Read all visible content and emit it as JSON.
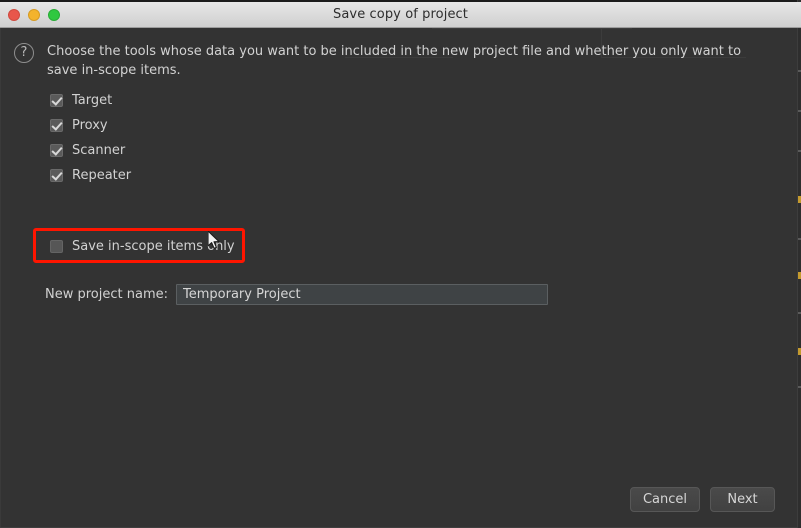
{
  "window": {
    "title": "Save copy of project",
    "traffic_lights": [
      {
        "name": "close",
        "color": "#e8564b"
      },
      {
        "name": "minimize",
        "color": "#f3b32c"
      },
      {
        "name": "zoom",
        "color": "#30c840"
      }
    ]
  },
  "dialog": {
    "help_icon": "?",
    "description": "Choose the tools whose data you want to be included in the new project file and whether you only want to save in-scope items.",
    "tools": [
      {
        "label": "Target",
        "checked": true
      },
      {
        "label": "Proxy",
        "checked": true
      },
      {
        "label": "Scanner",
        "checked": true
      },
      {
        "label": "Repeater",
        "checked": true
      }
    ],
    "scope_option": {
      "label": "Save in-scope items only",
      "checked": false,
      "highlight_color": "#ff1500"
    },
    "project_name": {
      "label": "New project name:",
      "value": "Temporary Project",
      "placeholder": "Temporary Project"
    },
    "buttons": {
      "cancel_label": "Cancel",
      "next_label": "Next"
    }
  },
  "colors": {
    "dialog_background": "#333333",
    "titlebar_background": "#dadada",
    "text": "#d2d2d2",
    "input_background": "#3f4345",
    "annotation": "#ff1500"
  }
}
